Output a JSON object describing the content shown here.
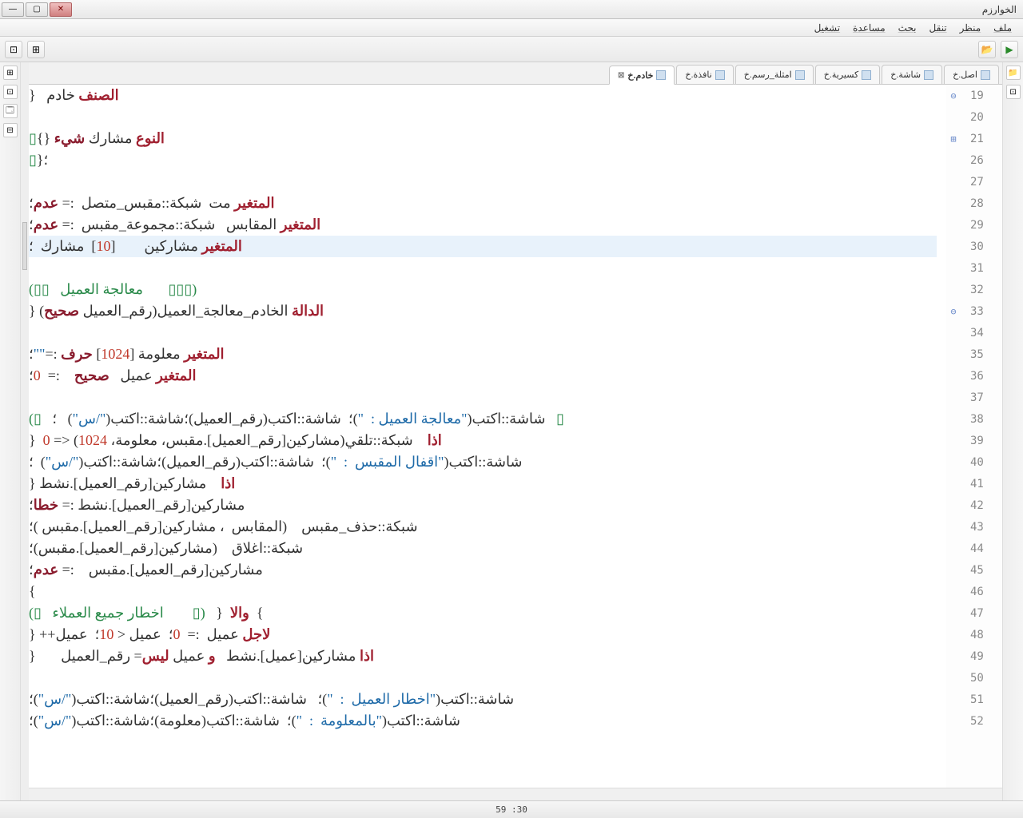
{
  "window": {
    "title": "الخوارزم"
  },
  "menu": {
    "file": "ملف",
    "view": "منظر",
    "navigate": "تنقل",
    "search": "بحث",
    "help": "مساعدة",
    "run": "تشغيل"
  },
  "tabs": [
    {
      "label": "اصل.خ"
    },
    {
      "label": "شاشة.خ"
    },
    {
      "label": "كسيرية.خ"
    },
    {
      "label": "امثلة_رسم.خ"
    },
    {
      "label": "نافذة.خ"
    },
    {
      "label": "خادم.خ",
      "active": true
    }
  ],
  "status": {
    "position": "59 :30"
  },
  "toolbar": {
    "run_icon": "▶",
    "open_icon": "📂",
    "view1_icon": "⊞",
    "view2_icon": "⊡"
  },
  "gutter_right": [
    "📁",
    "⊡"
  ],
  "gutter_left": [
    "⊞",
    "⊡",
    "🗔",
    "⊟"
  ],
  "code": {
    "lines": [
      {
        "n": 19,
        "fold": "⊖",
        "tokens": [
          [
            "kw",
            "الصنف"
          ],
          [
            "ident",
            " خادم   "
          ],
          [
            "punct",
            "{"
          ]
        ]
      },
      {
        "n": 20,
        "tokens": []
      },
      {
        "n": 21,
        "fold": "⊞",
        "tokens": [
          [
            "kw",
            "النوع"
          ],
          [
            "ident",
            " مشارك "
          ],
          [
            "type",
            "شيء"
          ],
          [
            "punct",
            " {}"
          ],
          [
            "icon-block",
            "▯"
          ]
        ]
      },
      {
        "n": 26,
        "tokens": [
          [
            "punct",
            "؛{"
          ],
          [
            "icon-block",
            "▯"
          ]
        ]
      },
      {
        "n": 27,
        "tokens": []
      },
      {
        "n": 28,
        "tokens": [
          [
            "kw",
            "المتغير"
          ],
          [
            "ident",
            " مت  شبكة::مقبس_متصل  := "
          ],
          [
            "type",
            "عدم"
          ],
          [
            "punct",
            "؛"
          ]
        ]
      },
      {
        "n": 29,
        "tokens": [
          [
            "kw",
            "المتغير"
          ],
          [
            "ident",
            " المقابس   شبكة::مجموعة_مقبس  := "
          ],
          [
            "type",
            "عدم"
          ],
          [
            "punct",
            "؛"
          ]
        ]
      },
      {
        "n": 30,
        "hl": true,
        "tokens": [
          [
            "kw",
            "المتغير"
          ],
          [
            "ident",
            " مشاركين        ["
          ],
          [
            "num",
            "10"
          ],
          [
            "ident",
            "]  مشارك  ؛"
          ]
        ]
      },
      {
        "n": 31,
        "tokens": []
      },
      {
        "n": 32,
        "tokens": [
          [
            "comment",
            "(▯▯▯       معالجة العميل   ▯▯)"
          ]
        ]
      },
      {
        "n": 33,
        "fold": "⊖",
        "tokens": [
          [
            "kw",
            "الدالة"
          ],
          [
            "ident",
            " الخادم_معالجة_العميل(رقم_العميل "
          ],
          [
            "type",
            "صحيح"
          ],
          [
            "ident",
            ") "
          ],
          [
            "punct",
            "{"
          ]
        ]
      },
      {
        "n": 34,
        "tokens": []
      },
      {
        "n": 35,
        "tokens": [
          [
            "kw",
            "المتغير"
          ],
          [
            "ident",
            " معلومة ["
          ],
          [
            "num",
            "1024"
          ],
          [
            "ident",
            "] "
          ],
          [
            "type",
            "حرف"
          ],
          [
            "ident",
            " :="
          ],
          [
            "str",
            "\"\""
          ],
          [
            "punct",
            "؛"
          ]
        ]
      },
      {
        "n": 36,
        "tokens": [
          [
            "kw",
            "المتغير"
          ],
          [
            "ident",
            " عميل   "
          ],
          [
            "type",
            "صحيح"
          ],
          [
            "ident",
            "    :=  "
          ],
          [
            "num",
            "0"
          ],
          [
            "punct",
            "؛"
          ]
        ]
      },
      {
        "n": 37,
        "tokens": []
      },
      {
        "n": 38,
        "tokens": [
          [
            "icon-block",
            "▯"
          ],
          [
            "ident",
            "   شاشة::اكتب("
          ],
          [
            "str",
            "\"معالجة العميل :  \""
          ],
          [
            "ident",
            ")؛  شاشة::اكتب(رقم_العميل)؛شاشة::اكتب("
          ],
          [
            "str",
            "\"/س\""
          ],
          [
            "ident",
            ")   ؛   "
          ],
          [
            "icon-block",
            "▯)"
          ]
        ]
      },
      {
        "n": 39,
        "tokens": [
          [
            "kw2",
            "اذا"
          ],
          [
            "ident",
            "    شبكة::تلقي(مشاركين[رقم_العميل].مقبس، معلومة، "
          ],
          [
            "num",
            "1024"
          ],
          [
            "ident",
            ") <= "
          ],
          [
            "num",
            "0"
          ],
          [
            "ident",
            "  "
          ],
          [
            "punct",
            "{"
          ]
        ]
      },
      {
        "n": 40,
        "tokens": [
          [
            "ident",
            "شاشة::اكتب("
          ],
          [
            "str",
            "\"اقفال المقبس  :  \""
          ],
          [
            "ident",
            ")؛  شاشة::اكتب(رقم_العميل)؛شاشة::اكتب("
          ],
          [
            "str",
            "\"/س\""
          ],
          [
            "ident",
            ")  ؛"
          ]
        ]
      },
      {
        "n": 41,
        "tokens": [
          [
            "kw2",
            "اذا"
          ],
          [
            "ident",
            "    مشاركين[رقم_العميل].نشط "
          ],
          [
            "punct",
            "{"
          ]
        ]
      },
      {
        "n": 42,
        "tokens": [
          [
            "ident",
            "مشاركين[رقم_العميل].نشط := "
          ],
          [
            "type",
            "خطا"
          ],
          [
            "punct",
            "؛"
          ]
        ]
      },
      {
        "n": 43,
        "tokens": [
          [
            "ident",
            "شبكة::حذف_مقبس    (المقابس  ، مشاركين[رقم_العميل].مقبس )؛"
          ]
        ]
      },
      {
        "n": 44,
        "tokens": [
          [
            "ident",
            "شبكة::اغلاق    (مشاركين[رقم_العميل].مقبس)؛"
          ]
        ]
      },
      {
        "n": 45,
        "tokens": [
          [
            "ident",
            "مشاركين[رقم_العميل].مقبس    := "
          ],
          [
            "type",
            "عدم"
          ],
          [
            "punct",
            "؛"
          ]
        ]
      },
      {
        "n": 46,
        "tokens": [
          [
            "punct",
            "}"
          ]
        ]
      },
      {
        "n": 47,
        "tokens": [
          [
            "punct",
            "}"
          ],
          [
            "ident",
            "  "
          ],
          [
            "kw2",
            "والا"
          ],
          [
            "ident",
            "  "
          ],
          [
            "punct",
            "{"
          ],
          [
            "ident",
            "   "
          ],
          [
            "comment",
            "(▯        اخطار جميع العملاء   ▯)"
          ]
        ]
      },
      {
        "n": 48,
        "tokens": [
          [
            "kw2",
            "لاجل"
          ],
          [
            "ident",
            " عميل  :=  "
          ],
          [
            "num",
            "0"
          ],
          [
            "ident",
            "؛  عميل < "
          ],
          [
            "num",
            "10"
          ],
          [
            "ident",
            "؛  عميل++ "
          ],
          [
            "punct",
            "{"
          ]
        ]
      },
      {
        "n": 49,
        "tokens": [
          [
            "kw2",
            "اذا"
          ],
          [
            "ident",
            " مشاركين[عميل].نشط   "
          ],
          [
            "kw2",
            "و"
          ],
          [
            "ident",
            " عميل "
          ],
          [
            "kw2",
            "ليس"
          ],
          [
            "ident",
            "= رقم_العميل       "
          ],
          [
            "punct",
            "{"
          ]
        ]
      },
      {
        "n": 50,
        "tokens": []
      },
      {
        "n": 51,
        "tokens": [
          [
            "ident",
            "شاشة::اكتب("
          ],
          [
            "str",
            "\"اخطار العميل  :  \""
          ],
          [
            "ident",
            ")؛   شاشة::اكتب(رقم_العميل)؛شاشة::اكتب("
          ],
          [
            "str",
            "\"/س\""
          ],
          [
            "ident",
            ")؛"
          ]
        ]
      },
      {
        "n": 52,
        "tokens": [
          [
            "ident",
            "شاشة::اكتب("
          ],
          [
            "str",
            "\"بالمعلومة  :  \""
          ],
          [
            "ident",
            ")؛  شاشة::اكتب(معلومة)؛شاشة::اكتب("
          ],
          [
            "str",
            "\"/س\""
          ],
          [
            "ident",
            ")؛"
          ]
        ]
      }
    ]
  }
}
